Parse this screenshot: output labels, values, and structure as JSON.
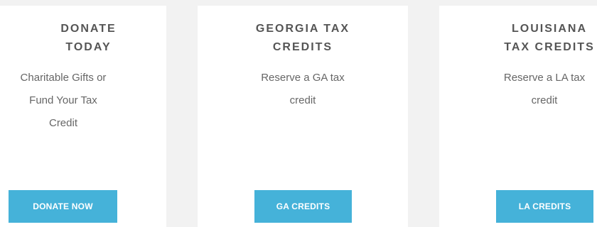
{
  "cards": [
    {
      "title": "DONATE\nTODAY",
      "description": "Charitable Gifts or\nFund Your Tax\nCredit",
      "button_label": "DONATE NOW"
    },
    {
      "title": "GEORGIA TAX\nCREDITS",
      "description": "Reserve a GA tax\ncredit",
      "button_label": "GA CREDITS"
    },
    {
      "title": "LOUISIANA\nTAX CREDITS",
      "description": "Reserve a LA tax\ncredit",
      "button_label": "LA CREDITS"
    }
  ],
  "colors": {
    "background": "#f2f2f2",
    "card": "#ffffff",
    "button": "#45b2d9",
    "title_text": "#555555",
    "body_text": "#666666"
  }
}
